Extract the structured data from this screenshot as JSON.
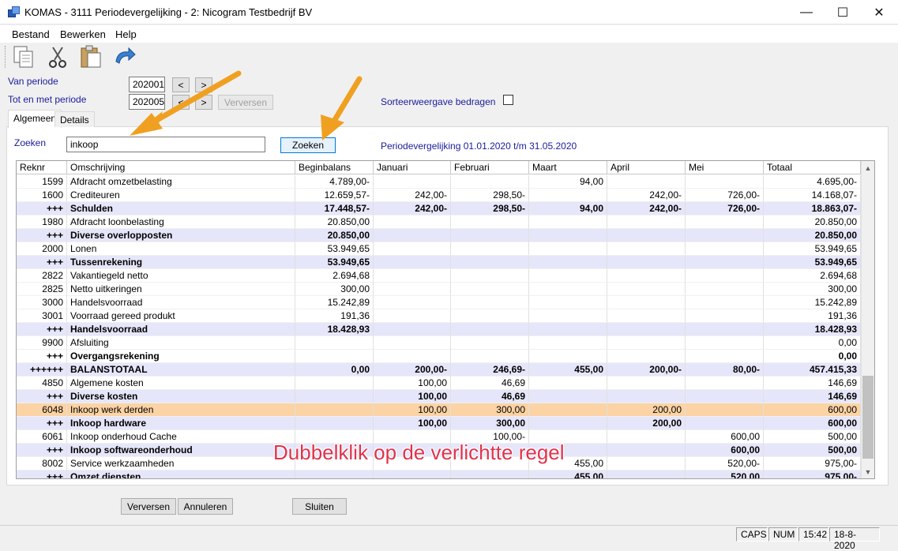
{
  "window": {
    "title": "KOMAS - 3111 Periodevergelijking - 2: Nicogram Testbedrijf BV",
    "minimize_glyph": "—",
    "maximize_glyph": "☐",
    "close_glyph": "✕"
  },
  "menu": {
    "items": [
      "Bestand",
      "Bewerken",
      "Help"
    ]
  },
  "toolbar": {
    "icons": [
      "copy-icon",
      "cut-icon",
      "paste-icon",
      "undo-icon"
    ]
  },
  "filters": {
    "van_periode_label": "Van periode",
    "van_periode_value": "202001",
    "tot_periode_label": "Tot en met periode",
    "tot_periode_value": "202005",
    "prev_label": "<",
    "next_label": ">",
    "verversen_label": "Verversen",
    "sorteer_label": "Sorteerweergave bedragen"
  },
  "tabs": [
    "Algemeen",
    "Details"
  ],
  "search": {
    "label": "Zoeken",
    "value": "inkoop",
    "button_label": "Zoeken",
    "period_text": "Periodevergelijking 01.01.2020 t/m 31.05.2020"
  },
  "grid": {
    "columns": [
      "Reknr",
      "Omschrijving",
      "Beginbalans",
      "Januari",
      "Februari",
      "Maart",
      "April",
      "Mei",
      "Totaal"
    ],
    "rows": [
      {
        "type": "normal",
        "cells": [
          "1599",
          "Afdracht omzetbelasting",
          "4.789,00-",
          "",
          "",
          "94,00",
          "",
          "",
          "4.695,00-"
        ]
      },
      {
        "type": "normal",
        "cells": [
          "1600",
          "Crediteuren",
          "12.659,57-",
          "242,00-",
          "298,50-",
          "",
          "242,00-",
          "726,00-",
          "14.168,07-"
        ]
      },
      {
        "type": "sub",
        "cells": [
          "+++",
          "Schulden",
          "17.448,57-",
          "242,00-",
          "298,50-",
          "94,00",
          "242,00-",
          "726,00-",
          "18.863,07-"
        ]
      },
      {
        "type": "normal",
        "cells": [
          "1980",
          "Afdracht loonbelasting",
          "20.850,00",
          "",
          "",
          "",
          "",
          "",
          "20.850,00"
        ]
      },
      {
        "type": "sub",
        "cells": [
          "+++",
          "Diverse overlopposten",
          "20.850,00",
          "",
          "",
          "",
          "",
          "",
          "20.850,00"
        ]
      },
      {
        "type": "normal",
        "cells": [
          "2000",
          "Lonen",
          "53.949,65",
          "",
          "",
          "",
          "",
          "",
          "53.949,65"
        ]
      },
      {
        "type": "sub",
        "cells": [
          "+++",
          "Tussenrekening",
          "53.949,65",
          "",
          "",
          "",
          "",
          "",
          "53.949,65"
        ]
      },
      {
        "type": "normal",
        "cells": [
          "2822",
          "Vakantiegeld netto",
          "2.694,68",
          "",
          "",
          "",
          "",
          "",
          "2.694,68"
        ]
      },
      {
        "type": "normal",
        "cells": [
          "2825",
          "Netto uitkeringen",
          "300,00",
          "",
          "",
          "",
          "",
          "",
          "300,00"
        ]
      },
      {
        "type": "normal",
        "cells": [
          "3000",
          "Handelsvoorraad",
          "15.242,89",
          "",
          "",
          "",
          "",
          "",
          "15.242,89"
        ]
      },
      {
        "type": "normal",
        "cells": [
          "3001",
          "Voorraad gereed produkt",
          "191,36",
          "",
          "",
          "",
          "",
          "",
          "191,36"
        ]
      },
      {
        "type": "sub",
        "cells": [
          "+++",
          "Handelsvoorraad",
          "18.428,93",
          "",
          "",
          "",
          "",
          "",
          "18.428,93"
        ]
      },
      {
        "type": "normal",
        "cells": [
          "9900",
          "Afsluiting",
          "",
          "",
          "",
          "",
          "",
          "",
          "0,00"
        ]
      },
      {
        "type": "subw",
        "cells": [
          "+++",
          "Overgangsrekening",
          "",
          "",
          "",
          "",
          "",
          "",
          "0,00"
        ]
      },
      {
        "type": "sub",
        "cells": [
          "++++++",
          "BALANSTOTAAL",
          "0,00",
          "200,00-",
          "246,69-",
          "455,00",
          "200,00-",
          "80,00-",
          "457.415,33"
        ]
      },
      {
        "type": "normal",
        "cells": [
          "4850",
          "Algemene kosten",
          "",
          "100,00",
          "46,69",
          "",
          "",
          "",
          "146,69"
        ]
      },
      {
        "type": "sub",
        "cells": [
          "+++",
          "Diverse kosten",
          "",
          "100,00",
          "46,69",
          "",
          "",
          "",
          "146,69"
        ]
      },
      {
        "type": "hl",
        "cells": [
          "6048",
          "Inkoop werk derden",
          "",
          "100,00",
          "300,00",
          "",
          "200,00",
          "",
          "600,00"
        ]
      },
      {
        "type": "sub",
        "cells": [
          "+++",
          "Inkoop hardware",
          "",
          "100,00",
          "300,00",
          "",
          "200,00",
          "",
          "600,00"
        ]
      },
      {
        "type": "normal",
        "cells": [
          "6061",
          "Inkoop onderhoud Cache",
          "",
          "",
          "100,00-",
          "",
          "",
          "600,00",
          "500,00"
        ]
      },
      {
        "type": "sub",
        "cells": [
          "+++",
          "Inkoop softwareonderhoud",
          "",
          "",
          "",
          "",
          "",
          "600,00",
          "500,00"
        ]
      },
      {
        "type": "normal",
        "cells": [
          "8002",
          "Service werkzaamheden",
          "",
          "",
          "",
          "455,00",
          "",
          "520,00-",
          "975,00-"
        ]
      },
      {
        "type": "sub",
        "cells": [
          "+++",
          "Omzet diensten",
          "",
          "",
          "",
          "455,00",
          "",
          "520,00",
          "975,00-"
        ]
      }
    ]
  },
  "buttons": {
    "verversen": "Verversen",
    "annuleren": "Annuleren",
    "sluiten": "Sluiten"
  },
  "statusbar": {
    "caps": "CAPS",
    "num": "NUM",
    "time": "15:42",
    "date": "18-8-2020"
  },
  "annotation": {
    "text": "Dubbelklik op de verlichtte regel",
    "color": "#e0334a",
    "arrow_color": "#f0a020"
  }
}
